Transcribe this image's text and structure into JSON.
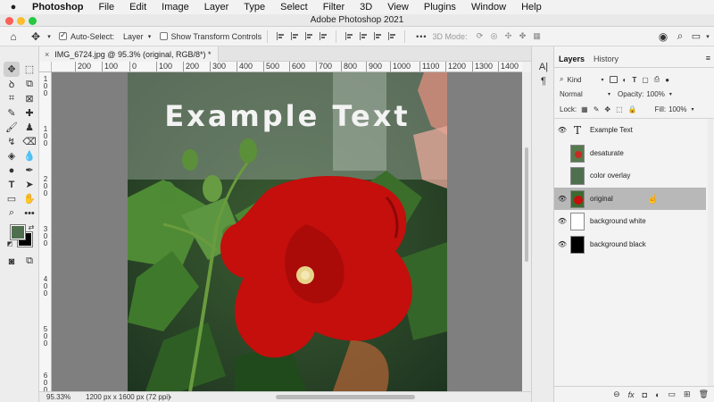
{
  "menubar": {
    "apple": "",
    "items": [
      "Photoshop",
      "File",
      "Edit",
      "Image",
      "Layer",
      "Type",
      "Select",
      "Filter",
      "3D",
      "View",
      "Plugins",
      "Window",
      "Help"
    ]
  },
  "window": {
    "title": "Adobe Photoshop 2021",
    "traffic_colors": [
      "#fe5f57",
      "#febc2e",
      "#28c840"
    ]
  },
  "options_bar": {
    "auto_select_label": "Auto-Select:",
    "auto_select_value": "Layer",
    "show_transform_label": "Show Transform Controls",
    "more": "•••",
    "mode_3d": "3D Mode:"
  },
  "document": {
    "tab_close": "×",
    "tab_title": "IMG_6724.jpg @ 95.3% (original, RGB/8*) *",
    "ruler_top": [
      "200",
      "100",
      "0",
      "100",
      "200",
      "300",
      "400",
      "500",
      "600",
      "700",
      "800",
      "900",
      "1000",
      "1100",
      "1200",
      "1300",
      "1400"
    ],
    "ruler_left": [
      "1",
      "0",
      "0",
      "1",
      "0",
      "0",
      "2",
      "0",
      "0",
      "3",
      "0",
      "0",
      "4",
      "0",
      "0",
      "5",
      "0",
      "0",
      "6",
      "0",
      "0"
    ],
    "overlay_text": "Example Text",
    "zoom": "95.33%",
    "dimensions": "1200 px x 1600 px (72 ppi)",
    "status_arrow": "›"
  },
  "layers_panel": {
    "tabs": [
      "Layers",
      "History"
    ],
    "filter_kind": "Kind",
    "blend_mode": "Normal",
    "opacity_label": "Opacity:",
    "opacity_value": "100%",
    "lock_label": "Lock:",
    "fill_label": "Fill:",
    "fill_value": "100%",
    "layers": [
      {
        "name": "Example Text",
        "kind": "text",
        "visible": true,
        "selected": false
      },
      {
        "name": "desaturate",
        "kind": "image",
        "visible": false,
        "selected": false
      },
      {
        "name": "color overlay",
        "kind": "fill",
        "visible": false,
        "selected": false
      },
      {
        "name": "original",
        "kind": "image",
        "visible": true,
        "selected": true
      },
      {
        "name": "background white",
        "kind": "white",
        "visible": true,
        "selected": false
      },
      {
        "name": "background black",
        "kind": "black",
        "visible": true,
        "selected": false
      }
    ],
    "bottom_icons": [
      "link-icon",
      "fx-icon",
      "mask-icon",
      "adjustment-icon",
      "group-icon",
      "new-layer-icon",
      "trash-icon"
    ],
    "bottom_glyphs": [
      "⊖",
      "fx",
      "◘",
      "◐",
      "▭",
      "⊞",
      "🗑"
    ]
  },
  "colors": {
    "foreground": "#4f6f4f",
    "background": "#000000",
    "overlay_swatch": "#4f6f4f",
    "selection": "#b8b8b8"
  }
}
